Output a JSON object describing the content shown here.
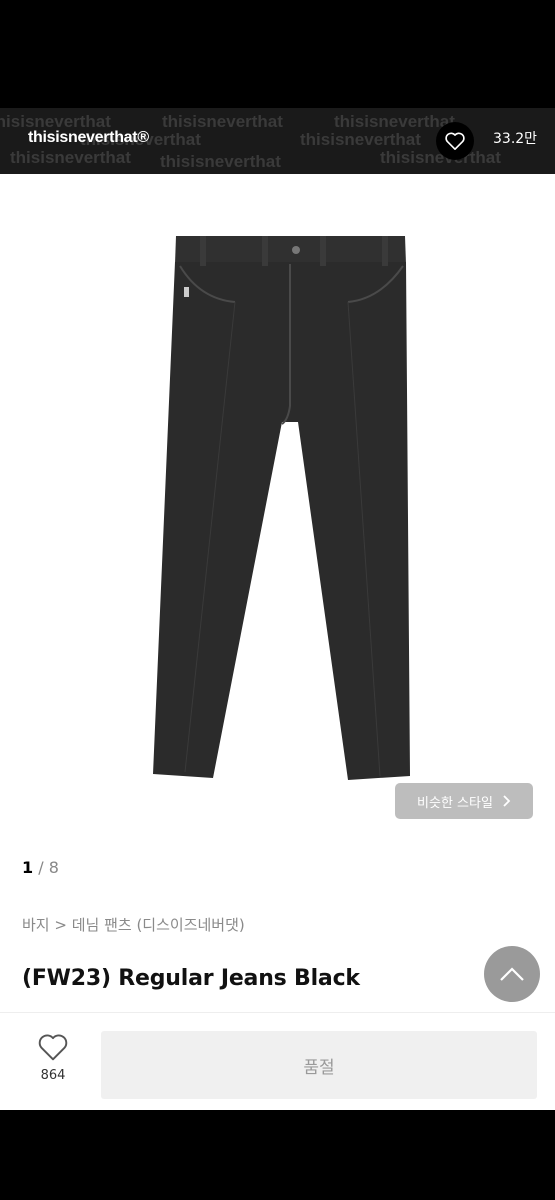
{
  "header": {
    "brand_name": "thisisneverthat®",
    "banner_pattern_text": "thisisneverthat",
    "favorite_count": "33.2만"
  },
  "product": {
    "image_alt": "Regular Jeans Black",
    "similar_style_label": "비슷한 스타일",
    "pager_current": "1",
    "pager_total": "8",
    "breadcrumb": "바지 > 데님 팬츠 (디스이즈네버댓)",
    "title": "(FW23) Regular Jeans Black"
  },
  "footer": {
    "like_count": "864",
    "soldout_label": "품절"
  },
  "icons": {
    "heart": "heart-icon",
    "chevron": "chevron-right-icon",
    "up": "chevron-up-icon"
  },
  "colors": {
    "jeans": "#2b2b2b",
    "soldout_bg": "#f0f0f0",
    "banner_bg": "#1a1a1a"
  }
}
